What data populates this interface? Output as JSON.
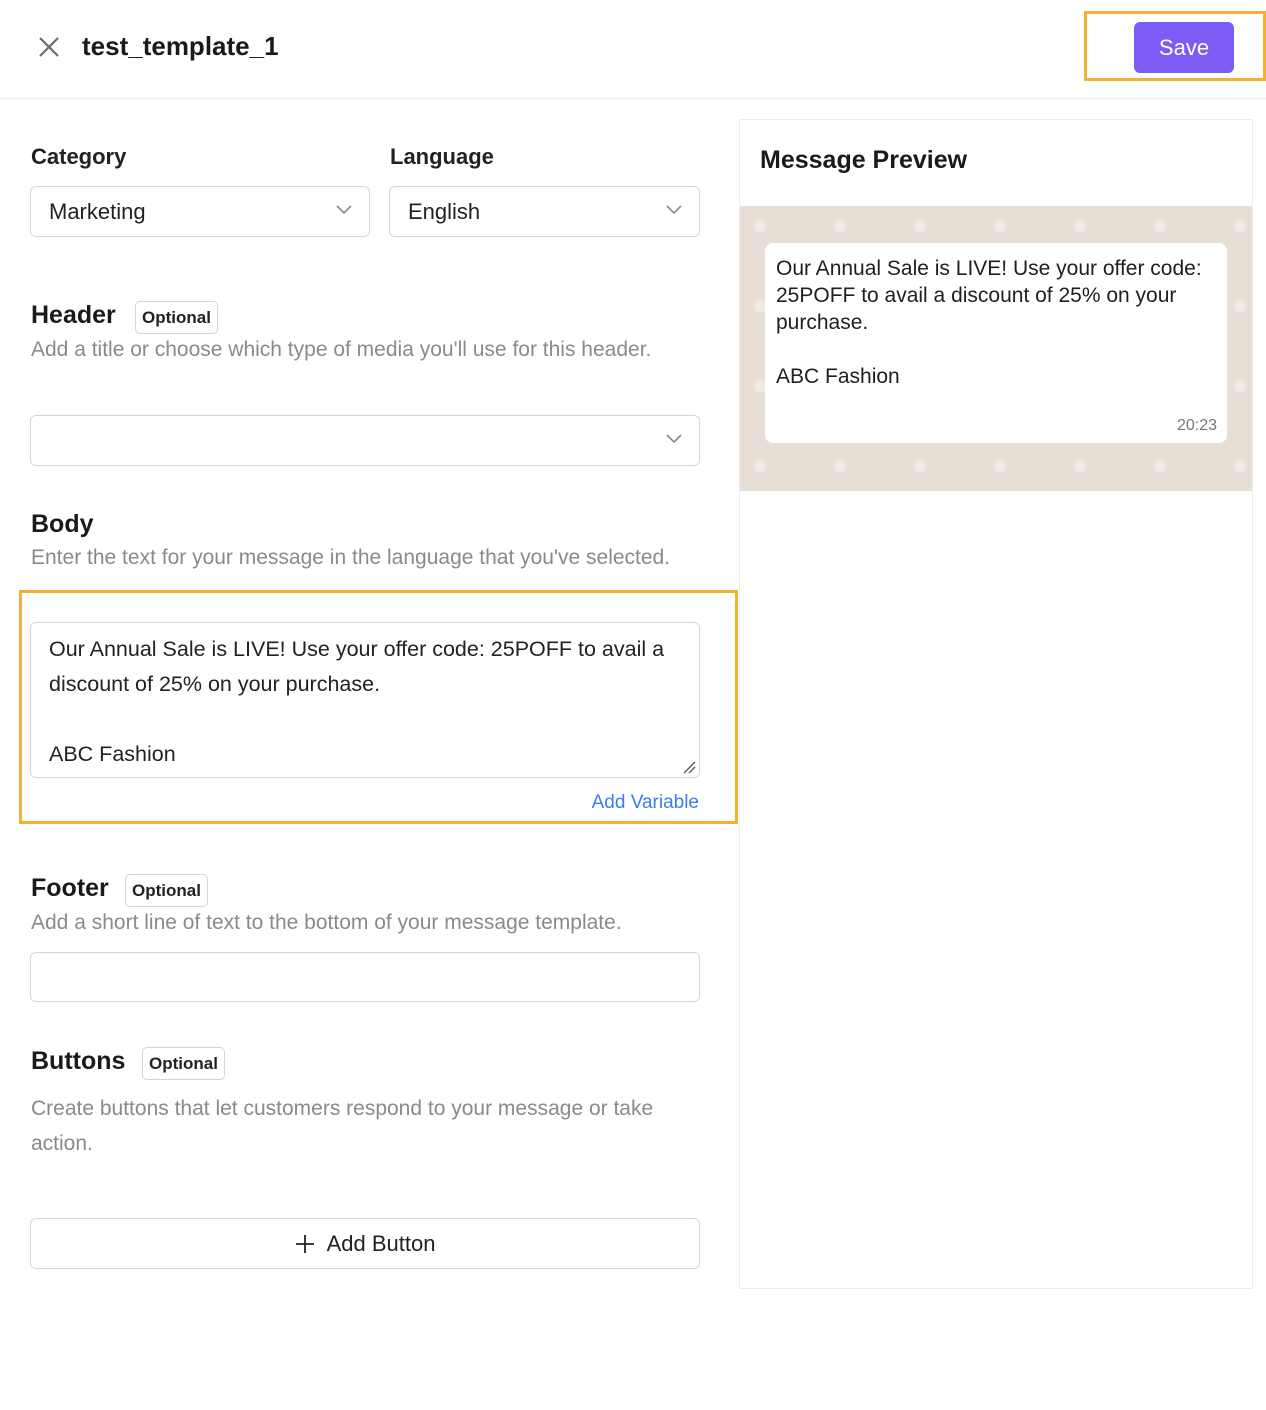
{
  "header": {
    "template_name": "test_template_1",
    "save_label": "Save"
  },
  "form": {
    "category": {
      "label": "Category",
      "value": "Marketing"
    },
    "language": {
      "label": "Language",
      "value": "English"
    },
    "header_section": {
      "title": "Header",
      "badge": "Optional",
      "description": "Add a title or choose which type of media you'll use for this header.",
      "value": ""
    },
    "body_section": {
      "title": "Body",
      "description": "Enter the text for your message in the language that you've selected.",
      "value": "Our Annual Sale is LIVE! Use your offer code: 25POFF to avail a discount of 25% on your purchase.\n\nABC Fashion",
      "add_variable_label": "Add Variable"
    },
    "footer_section": {
      "title": "Footer",
      "badge": "Optional",
      "description": "Add a short line of text to the bottom of your message template.",
      "value": ""
    },
    "buttons_section": {
      "title": "Buttons",
      "badge": "Optional",
      "description": "Create buttons that let customers respond to your message or take action.",
      "add_button_label": "Add Button"
    }
  },
  "preview": {
    "title": "Message Preview",
    "message": "Our Annual Sale is LIVE! Use your offer code: 25POFF to avail a discount of 25% on your purchase.\n\nABC Fashion",
    "time": "20:23"
  },
  "colors": {
    "accent": "#7c5cf5",
    "highlight": "#f2b134",
    "link": "#3c7bf0",
    "chat_background": "#e7dfd5"
  },
  "icons": {
    "close": "close-icon",
    "chevron": "chevron-down-icon",
    "plus": "plus-icon"
  }
}
